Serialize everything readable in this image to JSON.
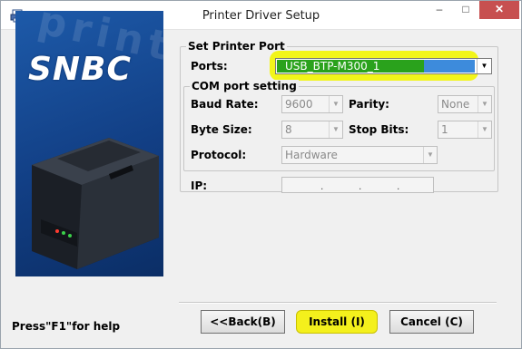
{
  "window": {
    "title": "Printer Driver Setup",
    "controls": {
      "minimize": "–",
      "maximize": "□",
      "close": "✕"
    }
  },
  "banner": {
    "logo": "SNBC",
    "watermark": "print"
  },
  "set_printer_port": {
    "group_title": "Set Printer Port",
    "ports_label": "Ports:",
    "ports_value": "USB_BTP-M300_1"
  },
  "com_port_setting": {
    "group_title": "COM port setting",
    "baud_rate_label": "Baud Rate:",
    "baud_rate_value": "9600",
    "parity_label": "Parity:",
    "parity_value": "None",
    "byte_size_label": "Byte Size:",
    "byte_size_value": "8",
    "stop_bits_label": "Stop Bits:",
    "stop_bits_value": "1",
    "protocol_label": "Protocol:",
    "protocol_value": "Hardware"
  },
  "ip": {
    "label": "IP:",
    "dot": "."
  },
  "footer": {
    "help_text": "Press\"F1\"for help",
    "back_label": "<<Back(B)",
    "install_label": "Install (I)",
    "cancel_label": "Cancel (C)"
  },
  "colors": {
    "highlight": "#f2f51a",
    "selection_blue": "#3d8bdc",
    "selection_green": "#2aa21c",
    "banner_blue": "#1d5aa9"
  }
}
